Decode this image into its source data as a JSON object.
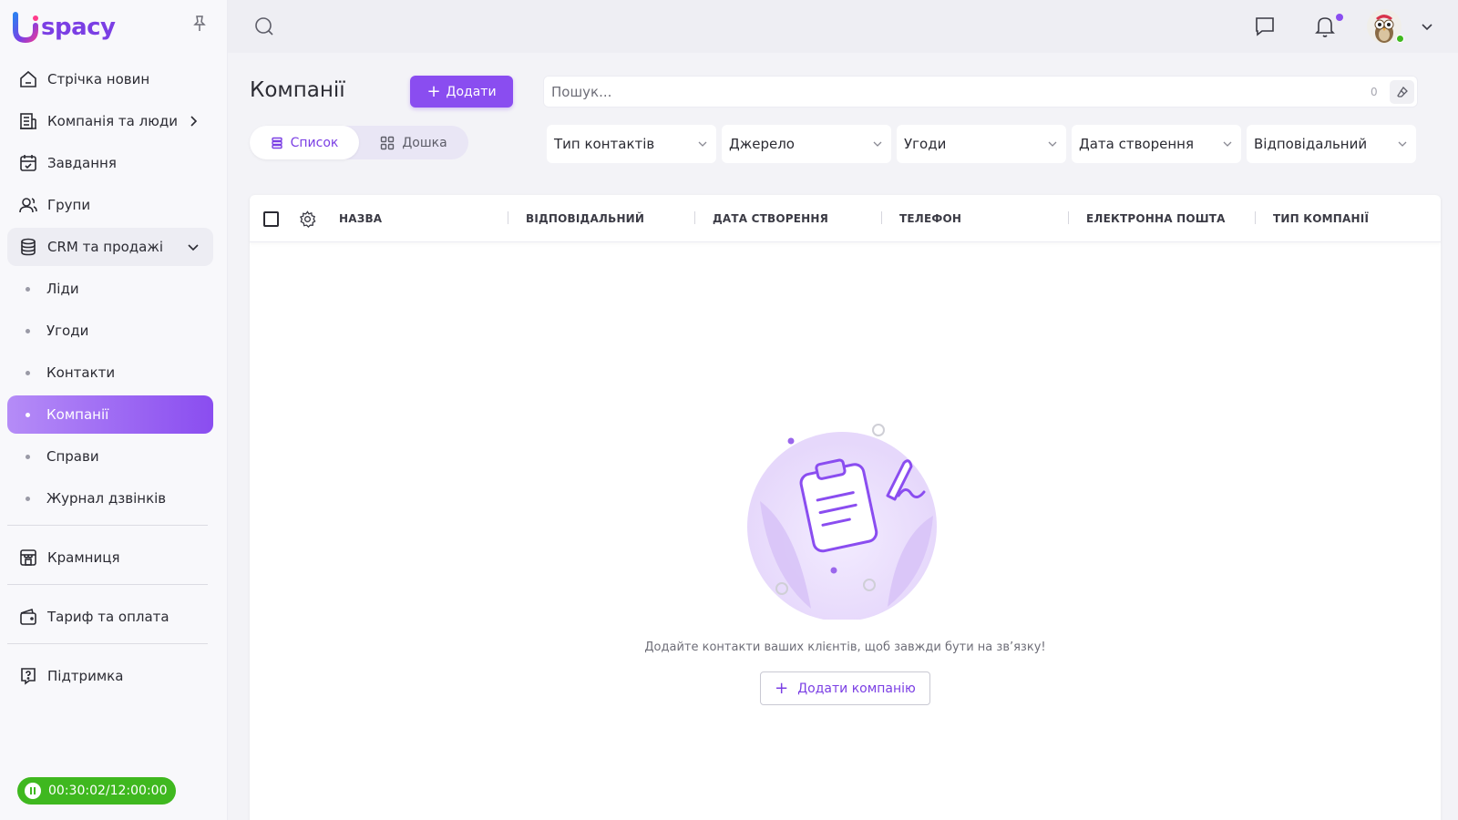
{
  "app": {
    "logo_text": "spacy"
  },
  "sidebar": {
    "items": [
      {
        "label": "Стрічка новин",
        "icon": "home-icon"
      },
      {
        "label": "Компанія та люди",
        "icon": "building-icon"
      },
      {
        "label": "Завдання",
        "icon": "calendar-check-icon"
      },
      {
        "label": "Групи",
        "icon": "users-icon"
      },
      {
        "label": "CRM та продажі",
        "icon": "database-icon"
      }
    ],
    "crm_sub": [
      {
        "label": "Ліди"
      },
      {
        "label": "Угоди"
      },
      {
        "label": "Контакти"
      },
      {
        "label": "Компанії",
        "active": true
      },
      {
        "label": "Справи"
      },
      {
        "label": "Журнал дзвінків"
      }
    ],
    "store": "Крамниця",
    "billing": "Тариф та оплата",
    "support": "Підтримка",
    "timer": "00:30:02/12:00:00"
  },
  "header": {
    "title": "Компанії",
    "add_label": "Додати",
    "search_placeholder": "Пошук...",
    "search_count": "0",
    "view_list": "Список",
    "view_board": "Дошка"
  },
  "filters": [
    "Тип контактів",
    "Джерело",
    "Угоди",
    "Дата створення",
    "Відповідальний"
  ],
  "table": {
    "columns": [
      "НАЗВА",
      "ВІДПОВІДАЛЬНИЙ",
      "ДАТА СТВОРЕННЯ",
      "ТЕЛЕФОН",
      "ЕЛЕКТРОННА ПОШТА",
      "ТИП КОМПАНІЇ"
    ]
  },
  "empty": {
    "text": "Додайте контакти ваших клієнтів, щоб завжди бути на зв’язку!",
    "button": "Додати компанію"
  },
  "colors": {
    "accent": "#8a4df0",
    "timer": "#3fb81f"
  }
}
